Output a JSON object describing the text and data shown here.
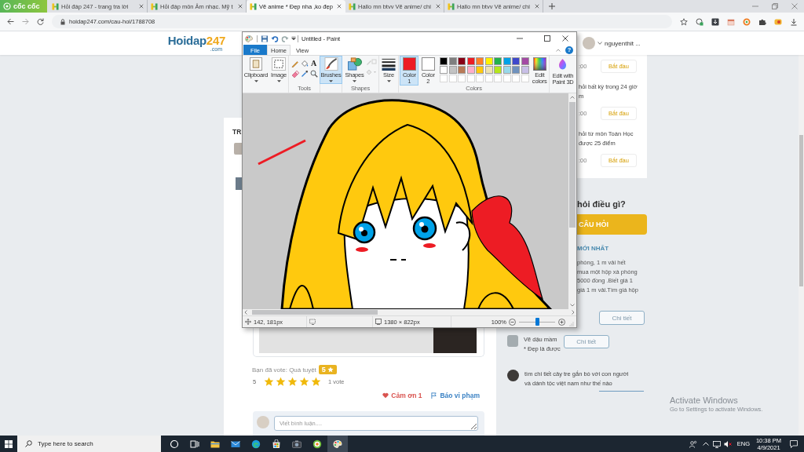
{
  "browser": {
    "brand": "cốc cốc",
    "tabs": [
      {
        "title": "Hỏi đáp 247 - trang tra lời",
        "selected": false
      },
      {
        "title": "Hỏi đáp môn Âm nhạc. Mỹ t",
        "selected": false
      },
      {
        "title": "Vẽ anime * Đẹp nha ,ko đẹp",
        "selected": true
      },
      {
        "title": "Hallo mn btvv Vẽ anime/ chi",
        "selected": false
      },
      {
        "title": "Hallo mn btvv Vẽ anime/ chi",
        "selected": false
      }
    ],
    "address": "hoidap247.com/cau-hoi/1788708"
  },
  "site": {
    "logo": {
      "name": "Hoidap",
      "number": "247",
      "domain": ".com"
    },
    "user": "nguyenthit ...",
    "question": {
      "title": "TR",
      "vote_text": "Bạn đã vote: Quá tuyệt",
      "badge": "5",
      "rating": "5",
      "stars": 5,
      "vote_count": "1 vote",
      "thanks": "Cảm ơn 1",
      "report": "Báo vi phạm",
      "comment_placeholder": "Viết bình luận...."
    },
    "sidebar": {
      "tasks": [
        {
          "time": ":00",
          "button": "Bắt đầu"
        },
        {
          "lines": [
            "hỏi bất kỳ trong 24 giờ",
            "m"
          ],
          "time": ":00",
          "button": "Bắt đầu"
        },
        {
          "lines": [
            "hỏi từ môn Toán Học",
            "được 25 điểm"
          ],
          "time": ":00",
          "button": "Bắt đầu"
        }
      ],
      "ask_heading": "hỏi điều gì?",
      "ask_button": "CÂU HỎI",
      "latest_heading": "MỚI NHẤT",
      "latest": [
        {
          "kind": "covered",
          "lines": [
            "phòng, 1 m vải hết",
            "mua một hộp xà phòng",
            "5000 đồng .Biết giá 1",
            "giá 1 m vải.Tìm giá hộp"
          ],
          "button": "Chi tiết"
        },
        {
          "kind": "entry",
          "title": "Vẽ dậu mầm",
          "text": "* Đẹp là được",
          "button": "Chi tiết"
        },
        {
          "kind": "entry",
          "lines": [
            "tìm chi tiết cây tre gắn bó với con người",
            "và dánh tộc việt nam như thế nào"
          ]
        }
      ]
    }
  },
  "paint": {
    "title": "Untitled - Paint",
    "tabs": [
      {
        "label": "File",
        "kind": "menu",
        "selected": false
      },
      {
        "label": "Home",
        "kind": "tab",
        "selected": true
      },
      {
        "label": "View",
        "kind": "tab",
        "selected": false
      }
    ],
    "help": "?",
    "ribbon": {
      "clipboard": "Clipboard",
      "image": "Image",
      "text_tool": "A",
      "tools_label": "Tools",
      "brushes": {
        "label": "Brushes",
        "selected": true
      },
      "shapes": "Shapes",
      "shapes_label": "Shapes",
      "size": "Size",
      "colors": [
        {
          "label": "Color",
          "number": "1",
          "color": "#ed1c24",
          "selected": true
        },
        {
          "label": "Color",
          "number": "2",
          "color": "#ffffff",
          "selected": false
        }
      ],
      "palette": [
        {
          "kind": "swatch",
          "color": "#000000"
        },
        {
          "kind": "swatch",
          "color": "#7f7f7f"
        },
        {
          "kind": "swatch",
          "color": "#880015"
        },
        {
          "kind": "swatch",
          "color": "#ed1c24"
        },
        {
          "kind": "swatch",
          "color": "#ff7f27"
        },
        {
          "kind": "swatch",
          "color": "#fff200"
        },
        {
          "kind": "swatch",
          "color": "#22b14c"
        },
        {
          "kind": "swatch",
          "color": "#00a2e8"
        },
        {
          "kind": "swatch",
          "color": "#3f48cc"
        },
        {
          "kind": "swatch",
          "color": "#a349a4"
        },
        {
          "kind": "swatch",
          "color": "#ffffff"
        },
        {
          "kind": "swatch",
          "color": "#c3c3c3"
        },
        {
          "kind": "swatch",
          "color": "#b97a57"
        },
        {
          "kind": "swatch",
          "color": "#ffaec9"
        },
        {
          "kind": "swatch",
          "color": "#ffc90e"
        },
        {
          "kind": "swatch",
          "color": "#efe4b0"
        },
        {
          "kind": "swatch",
          "color": "#b5e61d"
        },
        {
          "kind": "swatch",
          "color": "#99d9ea"
        },
        {
          "kind": "swatch",
          "color": "#7092be"
        },
        {
          "kind": "swatch",
          "color": "#c8bfe7"
        },
        {
          "kind": "empty"
        },
        {
          "kind": "empty"
        },
        {
          "kind": "empty"
        },
        {
          "kind": "empty"
        },
        {
          "kind": "empty"
        },
        {
          "kind": "empty"
        },
        {
          "kind": "empty"
        },
        {
          "kind": "empty"
        },
        {
          "kind": "empty"
        },
        {
          "kind": "empty"
        }
      ],
      "edit_colors": [
        "Edit",
        "colors"
      ],
      "paint3d": [
        "Edit with",
        "Paint 3D"
      ],
      "colors_label": "Colors"
    },
    "status": {
      "position": "142, 181px",
      "canvas_size": "1380 × 822px",
      "zoom": "100%",
      "zoom_slider": {
        "level": 0.5
      }
    }
  },
  "taskbar": {
    "search_placeholder": "Type here to search",
    "apps": [
      {
        "kind": "cortana",
        "selected": false
      },
      {
        "kind": "task-view",
        "selected": false
      },
      {
        "kind": "folder",
        "selected": false
      },
      {
        "kind": "mail",
        "selected": false
      },
      {
        "kind": "edge",
        "selected": false
      },
      {
        "kind": "store",
        "selected": false
      },
      {
        "kind": "camera",
        "selected": false
      },
      {
        "kind": "browser",
        "selected": false
      },
      {
        "kind": "paint",
        "selected": true
      }
    ],
    "language": "ENG",
    "time": "10:38 PM",
    "date": "4/9/2021"
  },
  "activation_notice": {
    "title": "Activate Windows",
    "text": "Go to Settings to activate Windows."
  }
}
